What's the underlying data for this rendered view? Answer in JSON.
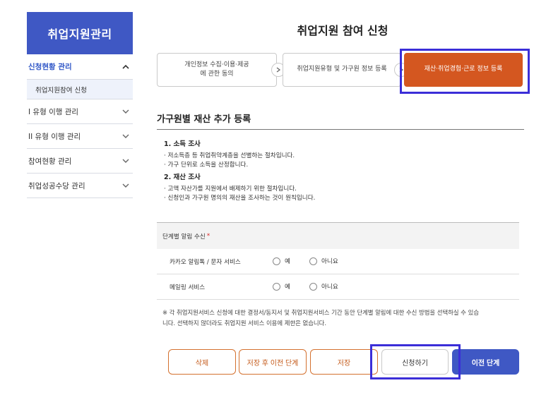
{
  "sidebar": {
    "title": "취업지원관리",
    "items": [
      {
        "label": "신청현황 관리",
        "icon": "chevron-up-icon"
      },
      {
        "label": "취업지원참여 신청"
      },
      {
        "label": "I 유형 이행 관리",
        "icon": "chevron-down-icon"
      },
      {
        "label": "II 유형 이행 관리",
        "icon": "chevron-down-icon"
      },
      {
        "label": "참여현황 관리",
        "icon": "chevron-down-icon"
      },
      {
        "label": "취업성공수당 관리",
        "icon": "chevron-down-icon"
      }
    ]
  },
  "page": {
    "title": "취업지원 참여 신청"
  },
  "steps": [
    {
      "line1": "개인정보 수집·이용·제공",
      "line2": "에 관한 동의"
    },
    {
      "line1": "취업지원유형 및 가구원 정보 등록"
    },
    {
      "line1": "재산·취업경험·근로 정보 등록"
    }
  ],
  "section": {
    "title": "가구원별 재산 추가 등록",
    "info": {
      "h1": "1. 소득 조사",
      "l1": "· 저소득층 등 취업취약계층을 선별하는 절차입니다.",
      "l2": "· 가구 단위로 소득을 산정합니다.",
      "h2": "2. 재산 조사",
      "l3": "· 고액 자산가를 지원에서 배제하기 위한 절차입니다.",
      "l4": "· 신청인과 가구원 명의의 재산을 조사하는 것이 원칙입니다."
    }
  },
  "notify": {
    "header": "단계별 알림 수신",
    "required_mark": "*",
    "rows": [
      {
        "label": "카카오 알림톡 / 문자 서비스",
        "yes": "예",
        "no": "아니요"
      },
      {
        "label": "메일링 서비스",
        "yes": "예",
        "no": "아니요"
      }
    ],
    "note_line1": "※ 각 취업지원서비스 신청에 대한 결정서/동지서 및 취업지원서비스 기간 동안 단계별 알림에 대한 수신 방법을 선택하실 수 있습",
    "note_line2": "니다. 선택하지 않더라도 취업지원 서비스 이용에 제한은 없습니다."
  },
  "buttons": {
    "delete": "삭제",
    "save_prev": "저장 후 이전 단계",
    "save": "저장",
    "apply": "신청하기",
    "prev": "이전 단계"
  },
  "colors": {
    "brand_blue": "#3f58c4",
    "active_step": "#d45720",
    "highlight": "#3b2ed8"
  }
}
